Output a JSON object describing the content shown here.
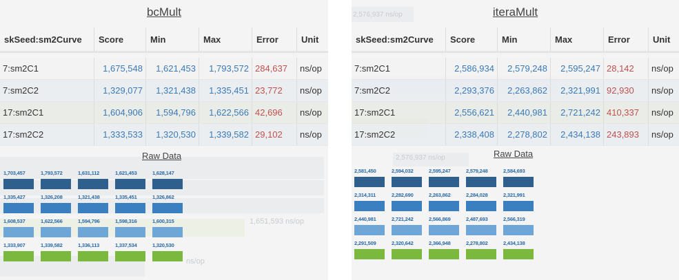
{
  "columns": [
    "skSeed:sm2Curve",
    "Score",
    "Min",
    "Max",
    "Error",
    "Unit"
  ],
  "colors": {
    "number": "#3a7ab8",
    "error": "#c0504d",
    "bars": [
      "#2f5f8c",
      "#3a7fc0",
      "#6ea6d8",
      "#7ab83e"
    ]
  },
  "left": {
    "title": "bcMult",
    "rows": [
      {
        "key": "7:sm2C1",
        "score": "1,675,548",
        "min": "1,621,453",
        "max": "1,793,572",
        "error": "284,637",
        "unit": "ns/op"
      },
      {
        "key": "7:sm2C2",
        "score": "1,329,077",
        "min": "1,321,438",
        "max": "1,335,451",
        "error": "23,772",
        "unit": "ns/op"
      },
      {
        "key": "17:sm2C1",
        "score": "1,604,906",
        "min": "1,594,796",
        "max": "1,622,566",
        "error": "42,696",
        "unit": "ns/op"
      },
      {
        "key": "17:sm2C2",
        "score": "1,333,533",
        "min": "1,320,530",
        "max": "1,339,582",
        "error": "29,102",
        "unit": "ns/op"
      }
    ],
    "raw_title": "Raw Data",
    "raw": [
      [
        "1,703,457",
        "1,793,572",
        "1,631,112",
        "1,621,453",
        "1,628,147"
      ],
      [
        "1,335,427",
        "1,326,208",
        "1,321,438",
        "1,335,451",
        "1,326,862"
      ],
      [
        "1,608,537",
        "1,622,566",
        "1,594,796",
        "1,598,316",
        "1,600,315"
      ],
      [
        "1,333,907",
        "1,339,582",
        "1,336,113",
        "1,337,534",
        "1,320,530"
      ]
    ],
    "ghost": [
      "1,651,593 ns/op",
      "ns/op"
    ]
  },
  "right": {
    "title": "iteraMult",
    "rows": [
      {
        "key": "7:sm2C1",
        "score": "2,586,934",
        "min": "2,579,248",
        "max": "2,595,247",
        "error": "28,142",
        "unit": "ns/op"
      },
      {
        "key": "7:sm2C2",
        "score": "2,293,376",
        "min": "2,263,862",
        "max": "2,321,991",
        "error": "92,930",
        "unit": "ns/op"
      },
      {
        "key": "17:sm2C1",
        "score": "2,556,621",
        "min": "2,440,981",
        "max": "2,721,242",
        "error": "410,337",
        "unit": "ns/op"
      },
      {
        "key": "17:sm2C2",
        "score": "2,338,408",
        "min": "2,278,802",
        "max": "2,434,138",
        "error": "243,893",
        "unit": "ns/op"
      }
    ],
    "raw_title": "Raw Data",
    "raw": [
      [
        "2,581,450",
        "2,594,032",
        "2,595,247",
        "2,579,248",
        "2,584,693"
      ],
      [
        "2,314,311",
        "2,282,690",
        "2,263,862",
        "2,284,028",
        "2,321,991"
      ],
      [
        "2,440,981",
        "2,721,242",
        "2,566,869",
        "2,487,693",
        "2,566,319"
      ],
      [
        "2,291,509",
        "2,320,642",
        "2,366,948",
        "2,278,802",
        "2,434,138"
      ]
    ],
    "ghost": [
      "2,576,937 ns/op",
      "ns/op"
    ]
  }
}
